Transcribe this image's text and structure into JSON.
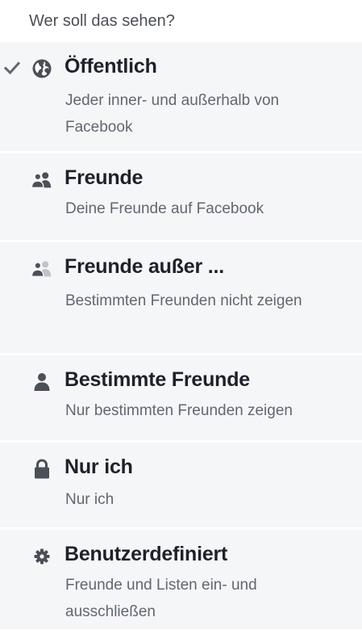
{
  "header": {
    "title": "Wer soll das sehen?"
  },
  "options": [
    {
      "icon": "globe-icon",
      "title": "Öffentlich",
      "description": "Jeder inner- und außerhalb von Facebook",
      "selected": true
    },
    {
      "icon": "friends-icon",
      "title": "Freunde",
      "description": "Deine Freunde auf Facebook",
      "selected": false
    },
    {
      "icon": "friends-except-icon",
      "title": "Freunde außer ...",
      "description": "Bestimmten Freunden nicht zeigen",
      "selected": false
    },
    {
      "icon": "person-icon",
      "title": "Bestimmte Freunde",
      "description": "Nur bestimmten Freunden zeigen",
      "selected": false
    },
    {
      "icon": "lock-icon",
      "title": "Nur ich",
      "description": "Nur ich",
      "selected": false
    },
    {
      "icon": "gear-icon",
      "title": "Benutzerdefiniert",
      "description": "Freunde und Listen ein- und ausschließen",
      "selected": false
    }
  ],
  "colors": {
    "icon": "#4b4f56",
    "icon_faded": "#bec3c9",
    "row_background": "#f5f6f7",
    "description": "#606770"
  }
}
